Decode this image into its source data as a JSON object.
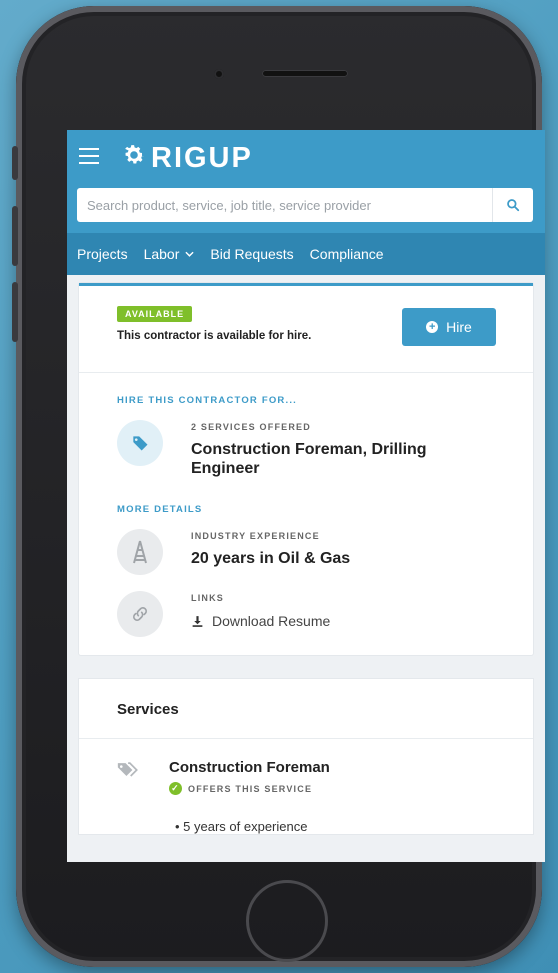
{
  "header": {
    "logo_text": "RIGUP",
    "search": {
      "placeholder": "Search product, service, job title, service provider"
    }
  },
  "nav": {
    "items": [
      {
        "label": "Projects"
      },
      {
        "label": "Labor"
      },
      {
        "label": "Bid Requests"
      },
      {
        "label": "Compliance"
      }
    ]
  },
  "availability": {
    "badge": "AVAILABLE",
    "message": "This contractor is available for hire.",
    "hire_label": "Hire"
  },
  "hire_section": {
    "label": "HIRE THIS CONTRACTOR FOR...",
    "services_offered_caption": "2 SERVICES OFFERED",
    "services_offered_value": "Construction Foreman, Drilling Engineer"
  },
  "more_details": {
    "label": "MORE DETAILS",
    "experience_caption": "INDUSTRY EXPERIENCE",
    "experience_value": "20 years in Oil & Gas",
    "links_caption": "LINKS",
    "download_label": "Download Resume"
  },
  "services": {
    "heading": "Services",
    "items": [
      {
        "title": "Construction Foreman",
        "offers_label": "OFFERS THIS SERVICE",
        "bullets": [
          "5 years of experience"
        ]
      }
    ]
  },
  "colors": {
    "brand_blue": "#3d9bc8",
    "nav_blue": "#2f86b2",
    "available_green": "#7fbf2a"
  },
  "icons": {
    "menu": "menu-icon",
    "logo": "gear-icon",
    "search": "search-icon",
    "hire": "plus-circle-icon",
    "services": "tag-icon",
    "experience": "oil-rig-icon",
    "links": "link-icon",
    "download": "download-icon",
    "check": "check-circle-icon"
  }
}
